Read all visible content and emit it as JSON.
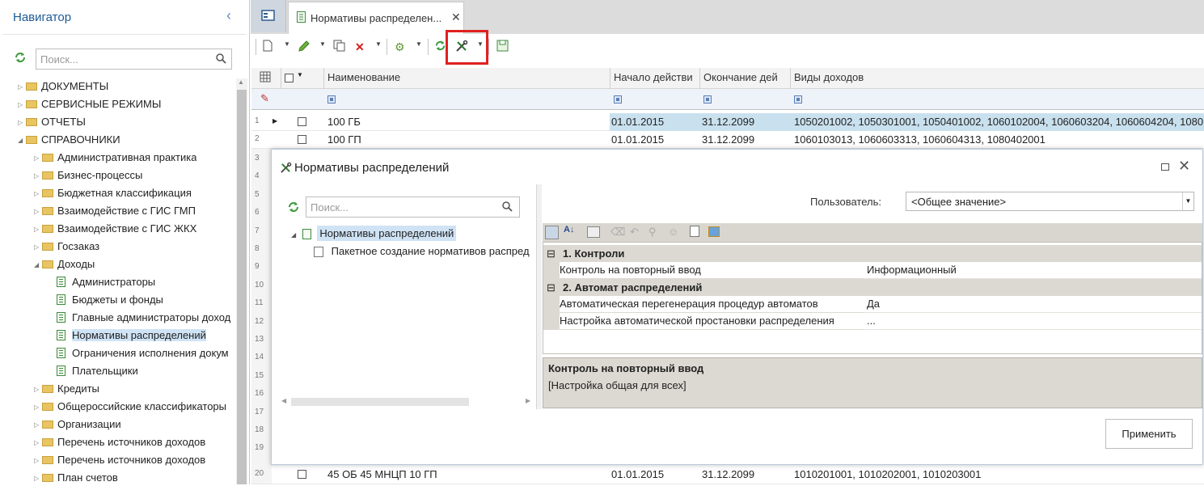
{
  "navigator": {
    "title": "Навигатор",
    "search_placeholder": "Поиск...",
    "tree": [
      {
        "label": "ДОКУМЕНТЫ",
        "expander": "▷",
        "icon": "folder-icon"
      },
      {
        "label": "СЕРВИСНЫЕ РЕЖИМЫ",
        "expander": "▷",
        "icon": "folder-icon"
      },
      {
        "label": "ОТЧЕТЫ",
        "expander": "▷",
        "icon": "folder-icon"
      },
      {
        "label": "СПРАВОЧНИКИ",
        "expander": "◢",
        "icon": "folder-icon"
      },
      {
        "label": "Административная практика",
        "expander": "▷",
        "icon": "folder-icon"
      },
      {
        "label": "Бизнес-процессы",
        "expander": "▷",
        "icon": "folder-icon"
      },
      {
        "label": "Бюджетная классификация",
        "expander": "▷",
        "icon": "folder-icon"
      },
      {
        "label": "Взаимодействие с ГИС ГМП",
        "expander": "▷",
        "icon": "folder-icon"
      },
      {
        "label": "Взаимодействие с ГИС ЖКХ",
        "expander": "▷",
        "icon": "folder-icon"
      },
      {
        "label": "Госзаказ",
        "expander": "▷",
        "icon": "folder-icon"
      },
      {
        "label": "Доходы",
        "expander": "◢",
        "icon": "folder-icon"
      },
      {
        "label": "Администраторы",
        "expander": "",
        "icon": "document-icon"
      },
      {
        "label": "Бюджеты и фонды",
        "expander": "",
        "icon": "document-icon"
      },
      {
        "label": "Главные администраторы доход",
        "expander": "",
        "icon": "document-icon"
      },
      {
        "label": "Нормативы распределений",
        "expander": "",
        "icon": "document-icon"
      },
      {
        "label": "Ограничения исполнения докум",
        "expander": "",
        "icon": "document-icon"
      },
      {
        "label": "Плательщики",
        "expander": "",
        "icon": "document-icon"
      },
      {
        "label": "Кредиты",
        "expander": "▷",
        "icon": "folder-icon"
      },
      {
        "label": "Общероссийские классификаторы",
        "expander": "▷",
        "icon": "folder-icon"
      },
      {
        "label": "Организации",
        "expander": "▷",
        "icon": "folder-icon"
      },
      {
        "label": "Перечень источников доходов",
        "expander": "▷",
        "icon": "folder-icon"
      },
      {
        "label": "Перечень источников доходов",
        "expander": "▷",
        "icon": "folder-icon"
      },
      {
        "label": "План счетов",
        "expander": "▷",
        "icon": "folder-icon"
      }
    ]
  },
  "tab": {
    "label": "Нормативы распределен...",
    "close": "✕"
  },
  "grid": {
    "columns": [
      "Наименование",
      "Начало действи",
      "Окончание дей",
      "Виды доходов"
    ],
    "rows": [
      {
        "num": "1",
        "name": "100 ГБ",
        "start": "01.01.2015",
        "end": "31.12.2099",
        "types": "1050201002,  1050301001,  1050401002,  1060102004,  1060603204,  1060604204,  1080"
      },
      {
        "num": "2",
        "name": "100 ГП",
        "start": "01.01.2015",
        "end": "31.12.2099",
        "types": "1060103013, 1060603313, 1060604313, 1080402001"
      },
      {
        "num": "20",
        "name": "45 ОБ 45 МНЦП 10 ГП",
        "start": "01.01.2015",
        "end": "31.12.2099",
        "types": "1010201001, 1010202001, 1010203001"
      }
    ],
    "row_numbers": [
      "3",
      "4",
      "5",
      "6",
      "7",
      "8",
      "9",
      "10",
      "11",
      "12",
      "13",
      "14",
      "15",
      "16",
      "17",
      "18",
      "19"
    ]
  },
  "dialog": {
    "title": "Нормативы распределений",
    "search_placeholder": "Поиск...",
    "tree_root": "Нормативы распределений",
    "tree_child": "Пакетное создание нормативов распред",
    "user_label": "Пользователь:",
    "user_value": "<Общее значение>",
    "categories": [
      {
        "toggle": "⊟",
        "title": "1. Контроли"
      },
      {
        "toggle": "⊟",
        "title": "2. Автомат распределений"
      }
    ],
    "properties": [
      {
        "name": "Контроль на повторный ввод",
        "value": "Информационный"
      },
      {
        "name": "Автоматическая перегенерация процедур автоматов",
        "value": "Да"
      },
      {
        "name": "Настройка автоматической простановки распределения",
        "value": "..."
      }
    ],
    "description_title": "Контроль на повторный ввод",
    "description_text": "[Настройка общая для всех]",
    "apply_label": "Применить"
  },
  "colors": {
    "accent": "#1a5a96",
    "highlight": "#e02020",
    "selected_row": "#c9e0ee"
  }
}
